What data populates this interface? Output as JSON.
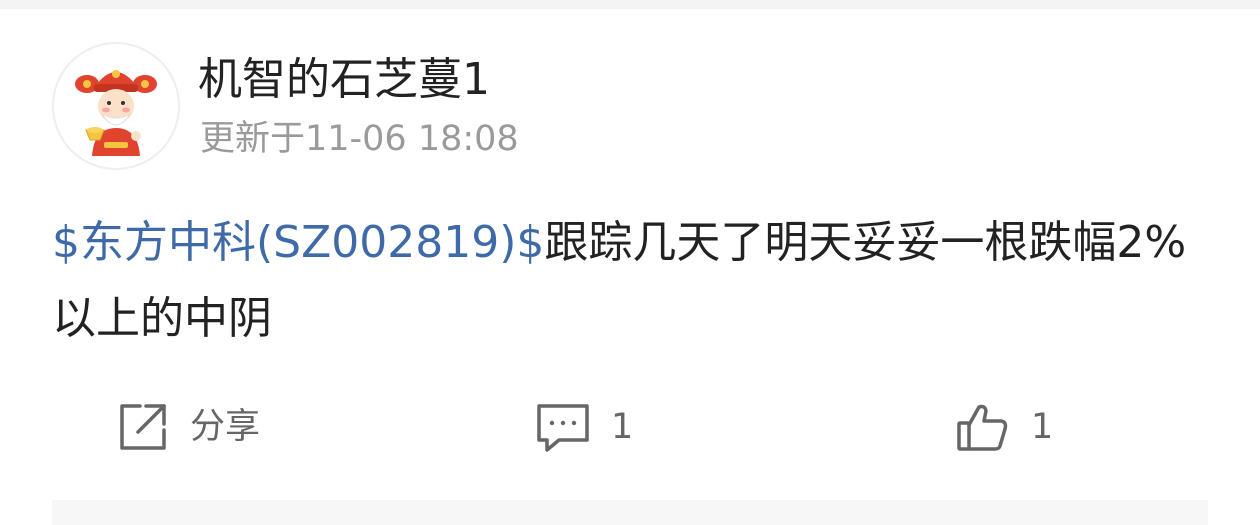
{
  "post": {
    "author": {
      "name": "机智的石芝蔓1",
      "avatar_icon": "god-of-wealth-avatar"
    },
    "updated": "更新于11-06 18:08",
    "content": {
      "stock_tag": "$东方中科(SZ002819)$",
      "text": "跟踪几天了明天妥妥一根跌幅2%以上的中阴"
    }
  },
  "actions": {
    "share": {
      "label": "分享",
      "icon": "share-icon"
    },
    "comment": {
      "count": "1",
      "icon": "comment-icon"
    },
    "like": {
      "count": "1",
      "icon": "thumbs-up-icon"
    }
  },
  "colors": {
    "link": "#3f6aa8",
    "text": "#222222",
    "muted": "#9a9a9a",
    "icon": "#666666"
  }
}
